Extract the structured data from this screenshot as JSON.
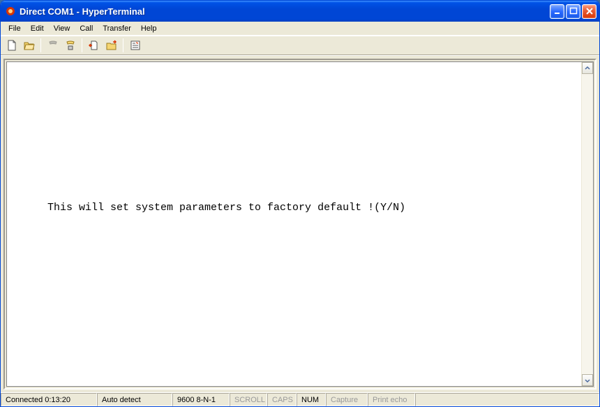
{
  "title": "Direct COM1 - HyperTerminal",
  "menu": {
    "file": "File",
    "edit": "Edit",
    "view": "View",
    "call": "Call",
    "transfer": "Transfer",
    "help": "Help"
  },
  "toolbar_icons": {
    "new": "new-doc-icon",
    "open": "open-folder-icon",
    "connect": "phone-connect-icon",
    "disconnect": "phone-disconnect-icon",
    "send": "send-file-icon",
    "receive": "receive-file-icon",
    "properties": "properties-icon"
  },
  "terminal": {
    "text": "This will set system parameters to factory default !(Y/N)"
  },
  "status": {
    "connection": "Connected 0:13:20",
    "auto_detect": "Auto detect",
    "port_settings": "9600 8-N-1",
    "scroll": "SCROLL",
    "caps": "CAPS",
    "num": "NUM",
    "capture": "Capture",
    "print_echo": "Print echo"
  }
}
